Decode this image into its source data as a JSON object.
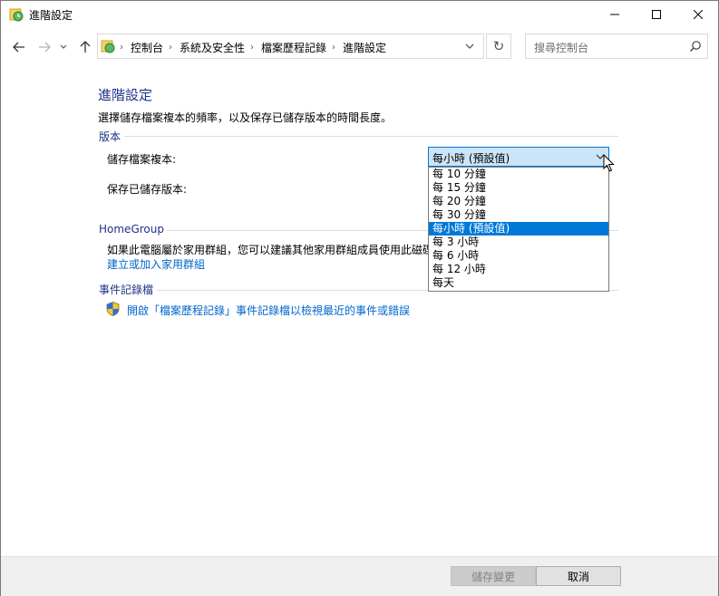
{
  "window": {
    "title": "進階設定",
    "minimize_icon": "minimize-icon",
    "maximize_icon": "maximize-icon",
    "close_icon": "close-icon"
  },
  "nav": {
    "breadcrumbs": [
      "控制台",
      "系統及安全性",
      "檔案歷程記錄",
      "進階設定"
    ],
    "search_placeholder": "搜尋控制台"
  },
  "main": {
    "title": "進階設定",
    "description": "選擇儲存檔案複本的頻率，以及保存已儲存版本的時間長度。",
    "versions": {
      "heading": "版本",
      "save_copies_label": "儲存檔案複本:",
      "keep_versions_label": "保存已儲存版本:",
      "frequency_selected": "每小時 (預設值)",
      "frequency_options": [
        "每 10 分鐘",
        "每 15 分鐘",
        "每 20 分鐘",
        "每 30 分鐘",
        "每小時 (預設值)",
        "每 3 小時",
        "每 6 小時",
        "每 12 小時",
        "每天"
      ],
      "selected_index": 4
    },
    "homegroup": {
      "heading": "HomeGroup",
      "text": "如果此電腦屬於家用群組，您可以建議其他家用群組成員使用此磁碟",
      "link": "建立或加入家用群組"
    },
    "eventlog": {
      "heading": "事件記錄檔",
      "link": "開啟「檔案歷程記錄」事件記錄檔以檢視最近的事件或錯誤"
    }
  },
  "footer": {
    "save_label": "儲存變更",
    "cancel_label": "取消"
  },
  "colors": {
    "accent": "#0078d7",
    "title_blue": "#1e3287",
    "link": "#0066cc"
  }
}
